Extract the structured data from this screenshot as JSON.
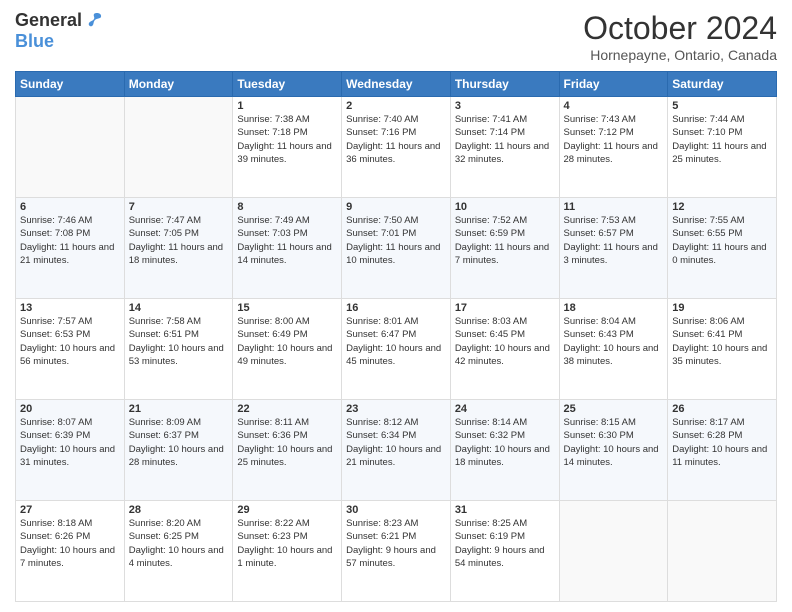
{
  "header": {
    "logo": {
      "general": "General",
      "blue": "Blue"
    },
    "title": "October 2024",
    "subtitle": "Hornepayne, Ontario, Canada"
  },
  "days_of_week": [
    "Sunday",
    "Monday",
    "Tuesday",
    "Wednesday",
    "Thursday",
    "Friday",
    "Saturday"
  ],
  "weeks": [
    [
      {
        "day": "",
        "sunrise": "",
        "sunset": "",
        "daylight": ""
      },
      {
        "day": "",
        "sunrise": "",
        "sunset": "",
        "daylight": ""
      },
      {
        "day": "1",
        "sunrise": "Sunrise: 7:38 AM",
        "sunset": "Sunset: 7:18 PM",
        "daylight": "Daylight: 11 hours and 39 minutes."
      },
      {
        "day": "2",
        "sunrise": "Sunrise: 7:40 AM",
        "sunset": "Sunset: 7:16 PM",
        "daylight": "Daylight: 11 hours and 36 minutes."
      },
      {
        "day": "3",
        "sunrise": "Sunrise: 7:41 AM",
        "sunset": "Sunset: 7:14 PM",
        "daylight": "Daylight: 11 hours and 32 minutes."
      },
      {
        "day": "4",
        "sunrise": "Sunrise: 7:43 AM",
        "sunset": "Sunset: 7:12 PM",
        "daylight": "Daylight: 11 hours and 28 minutes."
      },
      {
        "day": "5",
        "sunrise": "Sunrise: 7:44 AM",
        "sunset": "Sunset: 7:10 PM",
        "daylight": "Daylight: 11 hours and 25 minutes."
      }
    ],
    [
      {
        "day": "6",
        "sunrise": "Sunrise: 7:46 AM",
        "sunset": "Sunset: 7:08 PM",
        "daylight": "Daylight: 11 hours and 21 minutes."
      },
      {
        "day": "7",
        "sunrise": "Sunrise: 7:47 AM",
        "sunset": "Sunset: 7:05 PM",
        "daylight": "Daylight: 11 hours and 18 minutes."
      },
      {
        "day": "8",
        "sunrise": "Sunrise: 7:49 AM",
        "sunset": "Sunset: 7:03 PM",
        "daylight": "Daylight: 11 hours and 14 minutes."
      },
      {
        "day": "9",
        "sunrise": "Sunrise: 7:50 AM",
        "sunset": "Sunset: 7:01 PM",
        "daylight": "Daylight: 11 hours and 10 minutes."
      },
      {
        "day": "10",
        "sunrise": "Sunrise: 7:52 AM",
        "sunset": "Sunset: 6:59 PM",
        "daylight": "Daylight: 11 hours and 7 minutes."
      },
      {
        "day": "11",
        "sunrise": "Sunrise: 7:53 AM",
        "sunset": "Sunset: 6:57 PM",
        "daylight": "Daylight: 11 hours and 3 minutes."
      },
      {
        "day": "12",
        "sunrise": "Sunrise: 7:55 AM",
        "sunset": "Sunset: 6:55 PM",
        "daylight": "Daylight: 11 hours and 0 minutes."
      }
    ],
    [
      {
        "day": "13",
        "sunrise": "Sunrise: 7:57 AM",
        "sunset": "Sunset: 6:53 PM",
        "daylight": "Daylight: 10 hours and 56 minutes."
      },
      {
        "day": "14",
        "sunrise": "Sunrise: 7:58 AM",
        "sunset": "Sunset: 6:51 PM",
        "daylight": "Daylight: 10 hours and 53 minutes."
      },
      {
        "day": "15",
        "sunrise": "Sunrise: 8:00 AM",
        "sunset": "Sunset: 6:49 PM",
        "daylight": "Daylight: 10 hours and 49 minutes."
      },
      {
        "day": "16",
        "sunrise": "Sunrise: 8:01 AM",
        "sunset": "Sunset: 6:47 PM",
        "daylight": "Daylight: 10 hours and 45 minutes."
      },
      {
        "day": "17",
        "sunrise": "Sunrise: 8:03 AM",
        "sunset": "Sunset: 6:45 PM",
        "daylight": "Daylight: 10 hours and 42 minutes."
      },
      {
        "day": "18",
        "sunrise": "Sunrise: 8:04 AM",
        "sunset": "Sunset: 6:43 PM",
        "daylight": "Daylight: 10 hours and 38 minutes."
      },
      {
        "day": "19",
        "sunrise": "Sunrise: 8:06 AM",
        "sunset": "Sunset: 6:41 PM",
        "daylight": "Daylight: 10 hours and 35 minutes."
      }
    ],
    [
      {
        "day": "20",
        "sunrise": "Sunrise: 8:07 AM",
        "sunset": "Sunset: 6:39 PM",
        "daylight": "Daylight: 10 hours and 31 minutes."
      },
      {
        "day": "21",
        "sunrise": "Sunrise: 8:09 AM",
        "sunset": "Sunset: 6:37 PM",
        "daylight": "Daylight: 10 hours and 28 minutes."
      },
      {
        "day": "22",
        "sunrise": "Sunrise: 8:11 AM",
        "sunset": "Sunset: 6:36 PM",
        "daylight": "Daylight: 10 hours and 25 minutes."
      },
      {
        "day": "23",
        "sunrise": "Sunrise: 8:12 AM",
        "sunset": "Sunset: 6:34 PM",
        "daylight": "Daylight: 10 hours and 21 minutes."
      },
      {
        "day": "24",
        "sunrise": "Sunrise: 8:14 AM",
        "sunset": "Sunset: 6:32 PM",
        "daylight": "Daylight: 10 hours and 18 minutes."
      },
      {
        "day": "25",
        "sunrise": "Sunrise: 8:15 AM",
        "sunset": "Sunset: 6:30 PM",
        "daylight": "Daylight: 10 hours and 14 minutes."
      },
      {
        "day": "26",
        "sunrise": "Sunrise: 8:17 AM",
        "sunset": "Sunset: 6:28 PM",
        "daylight": "Daylight: 10 hours and 11 minutes."
      }
    ],
    [
      {
        "day": "27",
        "sunrise": "Sunrise: 8:18 AM",
        "sunset": "Sunset: 6:26 PM",
        "daylight": "Daylight: 10 hours and 7 minutes."
      },
      {
        "day": "28",
        "sunrise": "Sunrise: 8:20 AM",
        "sunset": "Sunset: 6:25 PM",
        "daylight": "Daylight: 10 hours and 4 minutes."
      },
      {
        "day": "29",
        "sunrise": "Sunrise: 8:22 AM",
        "sunset": "Sunset: 6:23 PM",
        "daylight": "Daylight: 10 hours and 1 minute."
      },
      {
        "day": "30",
        "sunrise": "Sunrise: 8:23 AM",
        "sunset": "Sunset: 6:21 PM",
        "daylight": "Daylight: 9 hours and 57 minutes."
      },
      {
        "day": "31",
        "sunrise": "Sunrise: 8:25 AM",
        "sunset": "Sunset: 6:19 PM",
        "daylight": "Daylight: 9 hours and 54 minutes."
      },
      {
        "day": "",
        "sunrise": "",
        "sunset": "",
        "daylight": ""
      },
      {
        "day": "",
        "sunrise": "",
        "sunset": "",
        "daylight": ""
      }
    ]
  ]
}
